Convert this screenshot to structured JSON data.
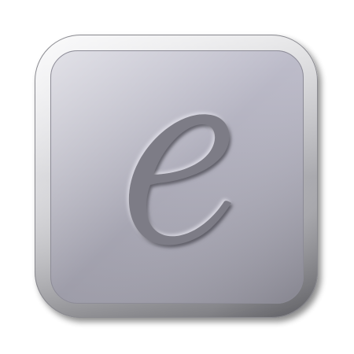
{
  "icon": {
    "name": "ebookit-app-icon",
    "glyph": "e",
    "colors": {
      "background": "#ffffff",
      "bezel_light": "#f4f4f6",
      "bezel_mid": "#c9c9cd",
      "bezel_dark": "#6d6d72",
      "face_top": "#bebdcb",
      "face_bottom": "#9d9ca8",
      "glyph_fill": "#7d7c86",
      "glyph_shadow": "#5e5d66",
      "glyph_highlight": "#d6d5de"
    }
  }
}
